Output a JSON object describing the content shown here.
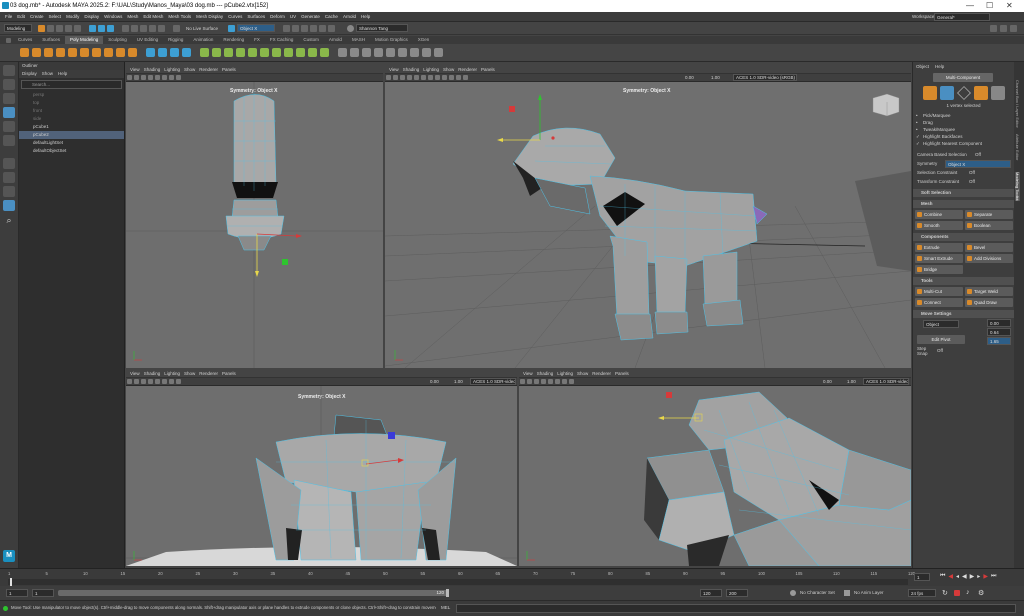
{
  "titlebar": {
    "title": "03 dog.mb* - Autodesk MAYA 2025.2: F:\\UAL\\Study\\Manos_Maya\\03 dog.mb  ---  pCube2.vtx[152]",
    "workspace_label": "Workspace:",
    "workspace_value": "General*"
  },
  "menus": [
    "File",
    "Edit",
    "Create",
    "Select",
    "Modify",
    "Display",
    "Windows",
    "Mesh",
    "Edit Mesh",
    "Mesh Tools",
    "Mesh Display",
    "Curves",
    "Surfaces",
    "Deform",
    "UV",
    "Generate",
    "Cache",
    "Arnold",
    "Help"
  ],
  "statusline": {
    "mode": "Modeling",
    "live_surface": "No Live Surface",
    "symmetry": "Object X",
    "user": "Shannon Tang"
  },
  "shelf_tabs": [
    "Curves",
    "Surfaces",
    "Poly Modeling",
    "Sculpting",
    "UV Editing",
    "Rigging",
    "Animation",
    "Rendering",
    "FX",
    "FX Caching",
    "Custom",
    "Arnold",
    "MASH",
    "Motion Graphics",
    "XGen"
  ],
  "shelf_active": "Poly Modeling",
  "outliner": {
    "title": "Outliner",
    "menus": [
      "Display",
      "Show",
      "Help"
    ],
    "search_placeholder": "Search...",
    "items": [
      {
        "label": "persp",
        "state": "dim"
      },
      {
        "label": "top",
        "state": "dim"
      },
      {
        "label": "front",
        "state": "dim"
      },
      {
        "label": "side",
        "state": "dim"
      },
      {
        "label": "pCube1",
        "state": "normal"
      },
      {
        "label": "pCube2",
        "state": "selected"
      },
      {
        "label": "defaultLightSet",
        "state": "normal"
      },
      {
        "label": "defaultObjectSet",
        "state": "normal"
      }
    ]
  },
  "viewport_menus": [
    "View",
    "Shading",
    "Lighting",
    "Show",
    "Renderer",
    "Panels"
  ],
  "viewports": {
    "front_top": {
      "symmetry": "Symmetry: Object X"
    },
    "persp": {
      "symmetry": "Symmetry: Object X",
      "exposure": "0.00",
      "gamma": "1.00",
      "colorspace": "ACES 1.0 SDR-video (sRGB)"
    },
    "bottom_left": {
      "symmetry": "Symmetry: Object X",
      "exposure": "0.00",
      "gamma": "1.00",
      "colorspace": "ACES 1.0 SDR-video"
    },
    "bottom_right": {
      "exposure": "0.00",
      "gamma": "1.00",
      "colorspace": "ACES 1.0 SDR-video"
    }
  },
  "modeling_toolkit": {
    "menus": [
      "Object",
      "Help"
    ],
    "multi_component": "Multi-Component",
    "selected_info": "1 vertex selected",
    "pick_options": [
      "Pick/Marquee",
      "Drag",
      "Tweak/Marquee"
    ],
    "highlight_options": [
      "Highlight Backfaces",
      "Highlight Nearest Component"
    ],
    "camera_based_label": "Camera Based Selection",
    "camera_based_value": "Off",
    "symmetry_label": "Symmetry",
    "symmetry_value": "Object X",
    "selection_constraint_label": "Selection Constraint",
    "selection_constraint_value": "Off",
    "transform_constraint_label": "Transform Constraint",
    "transform_constraint_value": "Off",
    "soft_selection": "Soft Selection",
    "mesh_section": "Mesh",
    "mesh_buttons": [
      "Combine",
      "Separate",
      "Smooth",
      "Boolean"
    ],
    "components_section": "Components",
    "components_buttons": [
      "Extrude",
      "Bevel",
      "Smart Extrude",
      "Add Divisions",
      "Bridge"
    ],
    "tools_section": "Tools",
    "tools_buttons": [
      "Multi-Cut",
      "Target Weld",
      "Connect",
      "Quad Draw"
    ],
    "move_settings": "Move Settings",
    "move_space": "Object",
    "move_x": "0.00",
    "move_y": "0.64",
    "move_z": "1.65",
    "edit_pivot": "Edit Pivot",
    "step_snap_label": "Step Snap",
    "step_snap_value": "Off"
  },
  "side_tabs": [
    "Channel Box / Layer Editor",
    "Attribute Editor",
    "Modeling Toolkit"
  ],
  "timeline": {
    "ticks": [
      "1",
      "5",
      "10",
      "15",
      "20",
      "25",
      "30",
      "35",
      "40",
      "45",
      "50",
      "55",
      "60",
      "65",
      "70",
      "75",
      "80",
      "85",
      "90",
      "95",
      "100",
      "105",
      "110",
      "115",
      "120"
    ],
    "current_frame": "1",
    "range_start": "1",
    "range_inner_start": "1",
    "range_inner_end": "120",
    "range_outer_end": "120",
    "range_end": "200",
    "character_set": "No Character Set",
    "anim_layer": "No Anim Layer",
    "fps": "24 fps"
  },
  "helpline": {
    "text": "Move Tool: Use manipulator to move object(s). Ctrl+middle-drag to move components along normals. Shift+drag manipulator axis or plane handles to extrude components or clone objects. Ctrl+Shift+drag to constrain movement to a con",
    "mel": "MEL"
  },
  "colors": {
    "accent": "#4a8fc2",
    "wire": "#4fc3e8",
    "mesh": "#a8a8a8",
    "viewport_bg": "#6e6e6e",
    "selected_outline": "#51627a"
  }
}
